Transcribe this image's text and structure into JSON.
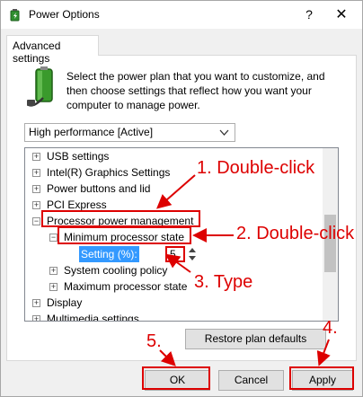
{
  "window": {
    "title": "Power Options",
    "help_glyph": "?",
    "close_glyph": "✕"
  },
  "tab": {
    "label": "Advanced settings"
  },
  "description": "Select the power plan that you want to customize, and then choose settings that reflect how you want your computer to manage power.",
  "plan_select": {
    "value": "High performance [Active]"
  },
  "tree": {
    "items": [
      {
        "label": "USB settings",
        "expander": "+"
      },
      {
        "label": "Intel(R) Graphics Settings",
        "expander": "+"
      },
      {
        "label": "Power buttons and lid",
        "expander": "+"
      },
      {
        "label": "PCI Express",
        "expander": "+"
      },
      {
        "label": "Processor power management",
        "expander": "−"
      },
      {
        "label": "Minimum processor state",
        "expander": "−"
      },
      {
        "label": "Setting (%):"
      },
      {
        "label": "System cooling policy",
        "expander": "+"
      },
      {
        "label": "Maximum processor state",
        "expander": "+"
      },
      {
        "label": "Display",
        "expander": "+"
      },
      {
        "label": "Multimedia settings",
        "expander": "+"
      }
    ],
    "setting_value": "5"
  },
  "buttons": {
    "restore": "Restore plan defaults",
    "ok": "OK",
    "cancel": "Cancel",
    "apply": "Apply"
  },
  "annotations": {
    "step1": "1. Double-click",
    "step2": "2. Double-click",
    "step3": "3. Type",
    "step4": "4.",
    "step5": "5."
  },
  "colors": {
    "annotation_red": "#dd0000",
    "selection_blue": "#3399ff"
  }
}
